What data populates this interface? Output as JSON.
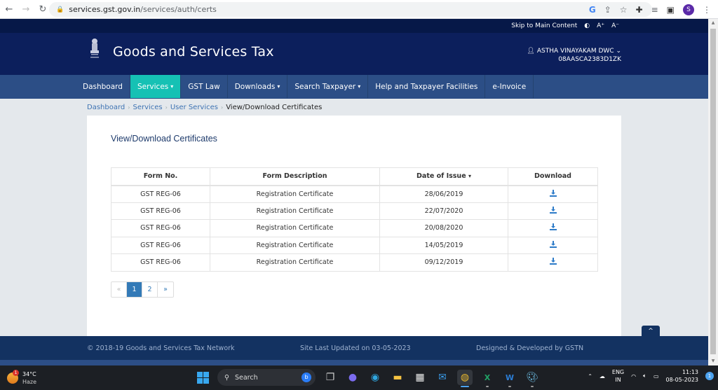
{
  "browser": {
    "url_host": "services.gst.gov.in",
    "url_path": "/services/auth/certs",
    "profile_initial": "S"
  },
  "topstrip": {
    "skip_link": "Skip to Main Content",
    "contrast_icon": "◐",
    "font_increase": "A⁺",
    "font_decrease": "A⁻"
  },
  "header": {
    "title": "Goods and Services Tax",
    "user_name": "ASTHA VINAYAKAM DWC",
    "gstin": "08AASCA2383D1ZK"
  },
  "menu": [
    {
      "label": "Dashboard",
      "dropdown": false,
      "active": false
    },
    {
      "label": "Services",
      "dropdown": true,
      "active": true
    },
    {
      "label": "GST Law",
      "dropdown": false,
      "active": false
    },
    {
      "label": "Downloads",
      "dropdown": true,
      "active": false
    },
    {
      "label": "Search Taxpayer",
      "dropdown": true,
      "active": false
    },
    {
      "label": "Help and Taxpayer Facilities",
      "dropdown": false,
      "active": false
    },
    {
      "label": "e-Invoice",
      "dropdown": false,
      "active": false
    }
  ],
  "breadcrumb": {
    "items": [
      "Dashboard",
      "Services",
      "User Services"
    ],
    "current": "View/Download Certificates"
  },
  "main": {
    "heading": "View/Download Certificates",
    "table": {
      "headers": [
        "Form No.",
        "Form Description",
        "Date of Issue",
        "Download"
      ],
      "sort_indicator": "▾",
      "rows": [
        {
          "form_no": "GST REG-06",
          "description": "Registration Certificate",
          "date": "28/06/2019"
        },
        {
          "form_no": "GST REG-06",
          "description": "Registration Certificate",
          "date": "22/07/2020"
        },
        {
          "form_no": "GST REG-06",
          "description": "Registration Certificate",
          "date": "20/08/2020"
        },
        {
          "form_no": "GST REG-06",
          "description": "Registration Certificate",
          "date": "14/05/2019"
        },
        {
          "form_no": "GST REG-06",
          "description": "Registration Certificate",
          "date": "09/12/2019"
        }
      ]
    },
    "pagination": {
      "prev": "«",
      "pages": [
        "1",
        "2"
      ],
      "current": "1",
      "next": "»"
    }
  },
  "footer": {
    "copyright": "© 2018-19 Goods and Services Tax Network",
    "updated": "Site Last Updated on 03-05-2023",
    "designed": "Designed & Developed by GSTN",
    "to_top": "^"
  },
  "taskbar": {
    "temperature": "34°C",
    "weather": "Haze",
    "weather_badge": "1",
    "search_label": "Search",
    "lang_line1": "ENG",
    "lang_line2": "IN",
    "time": "11:13",
    "date": "08-05-2023",
    "notification_count": "1"
  },
  "colors": {
    "header_bg": "#0c1f5c",
    "menu_bg": "#2c4e86",
    "menu_active": "#16c1b4",
    "footer_bg": "#133261",
    "link": "#3e73b3"
  }
}
